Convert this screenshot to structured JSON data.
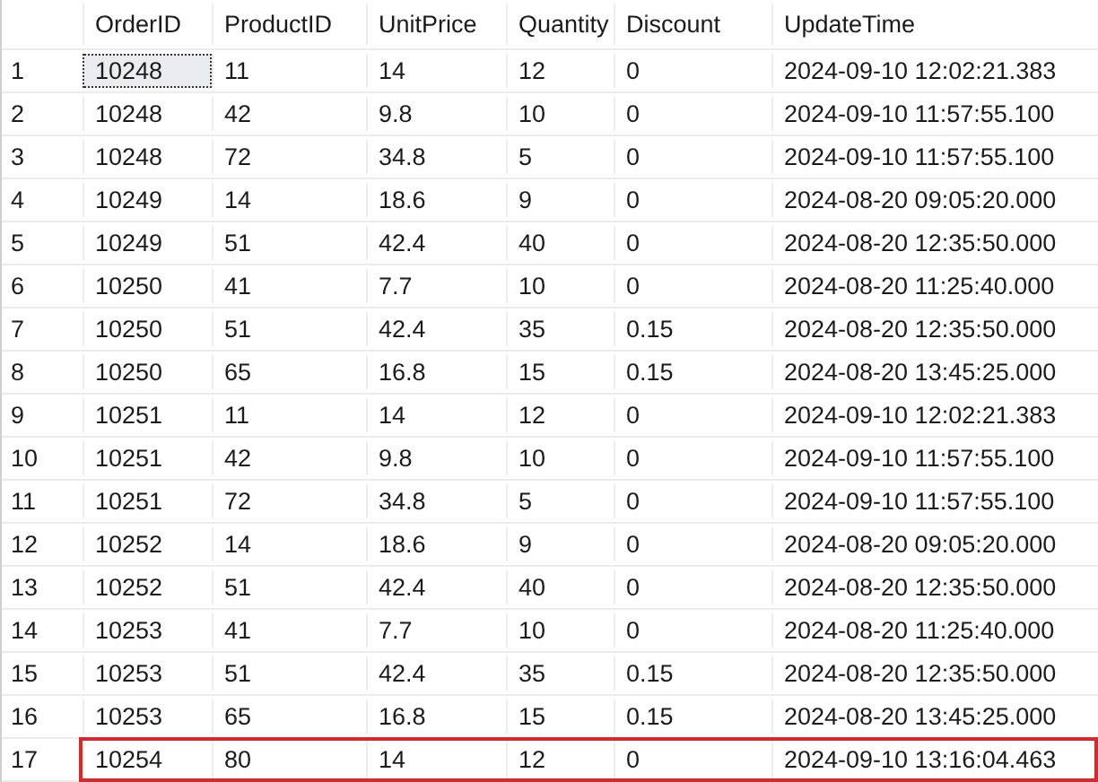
{
  "columns": [
    "OrderID",
    "ProductID",
    "UnitPrice",
    "Quantity",
    "Discount",
    "UpdateTime"
  ],
  "rows": [
    {
      "number": "1",
      "cells": [
        "10248",
        "11",
        "14",
        "12",
        "0",
        "2024-09-10 12:02:21.383"
      ],
      "focused": true,
      "highlighted": false
    },
    {
      "number": "2",
      "cells": [
        "10248",
        "42",
        "9.8",
        "10",
        "0",
        "2024-09-10 11:57:55.100"
      ],
      "focused": false,
      "highlighted": false
    },
    {
      "number": "3",
      "cells": [
        "10248",
        "72",
        "34.8",
        "5",
        "0",
        "2024-09-10 11:57:55.100"
      ],
      "focused": false,
      "highlighted": false
    },
    {
      "number": "4",
      "cells": [
        "10249",
        "14",
        "18.6",
        "9",
        "0",
        "2024-08-20 09:05:20.000"
      ],
      "focused": false,
      "highlighted": false
    },
    {
      "number": "5",
      "cells": [
        "10249",
        "51",
        "42.4",
        "40",
        "0",
        "2024-08-20 12:35:50.000"
      ],
      "focused": false,
      "highlighted": false
    },
    {
      "number": "6",
      "cells": [
        "10250",
        "41",
        "7.7",
        "10",
        "0",
        "2024-08-20 11:25:40.000"
      ],
      "focused": false,
      "highlighted": false
    },
    {
      "number": "7",
      "cells": [
        "10250",
        "51",
        "42.4",
        "35",
        "0.15",
        "2024-08-20 12:35:50.000"
      ],
      "focused": false,
      "highlighted": false
    },
    {
      "number": "8",
      "cells": [
        "10250",
        "65",
        "16.8",
        "15",
        "0.15",
        "2024-08-20 13:45:25.000"
      ],
      "focused": false,
      "highlighted": false
    },
    {
      "number": "9",
      "cells": [
        "10251",
        "11",
        "14",
        "12",
        "0",
        "2024-09-10 12:02:21.383"
      ],
      "focused": false,
      "highlighted": false
    },
    {
      "number": "10",
      "cells": [
        "10251",
        "42",
        "9.8",
        "10",
        "0",
        "2024-09-10 11:57:55.100"
      ],
      "focused": false,
      "highlighted": false
    },
    {
      "number": "11",
      "cells": [
        "10251",
        "72",
        "34.8",
        "5",
        "0",
        "2024-09-10 11:57:55.100"
      ],
      "focused": false,
      "highlighted": false
    },
    {
      "number": "12",
      "cells": [
        "10252",
        "14",
        "18.6",
        "9",
        "0",
        "2024-08-20 09:05:20.000"
      ],
      "focused": false,
      "highlighted": false
    },
    {
      "number": "13",
      "cells": [
        "10252",
        "51",
        "42.4",
        "40",
        "0",
        "2024-08-20 12:35:50.000"
      ],
      "focused": false,
      "highlighted": false
    },
    {
      "number": "14",
      "cells": [
        "10253",
        "41",
        "7.7",
        "10",
        "0",
        "2024-08-20 11:25:40.000"
      ],
      "focused": false,
      "highlighted": false
    },
    {
      "number": "15",
      "cells": [
        "10253",
        "51",
        "42.4",
        "35",
        "0.15",
        "2024-08-20 12:35:50.000"
      ],
      "focused": false,
      "highlighted": false
    },
    {
      "number": "16",
      "cells": [
        "10253",
        "65",
        "16.8",
        "15",
        "0.15",
        "2024-08-20 13:45:25.000"
      ],
      "focused": false,
      "highlighted": false
    },
    {
      "number": "17",
      "cells": [
        "10254",
        "80",
        "14",
        "12",
        "0",
        "2024-09-10 13:16:04.463"
      ],
      "focused": false,
      "highlighted": true
    }
  ]
}
